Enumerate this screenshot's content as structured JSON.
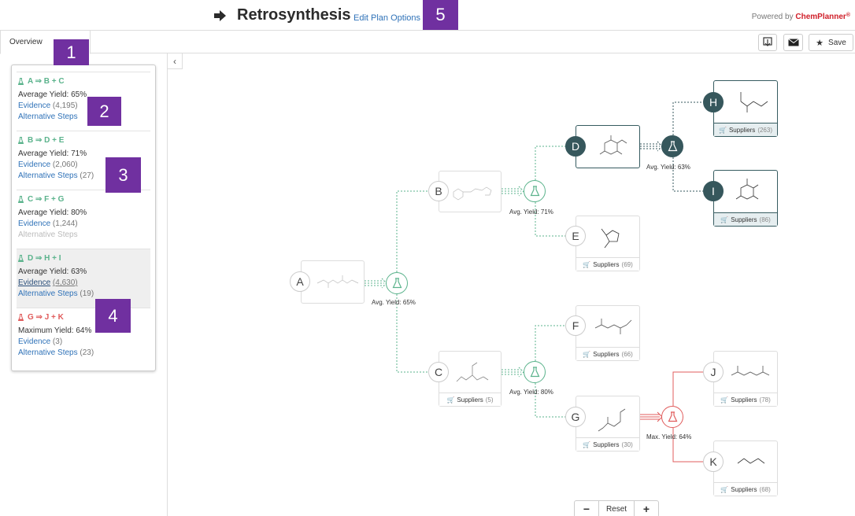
{
  "header": {
    "title": "Retrosynthesis",
    "edit_link": "Edit Plan Options",
    "powered_prefix": "Powered by ",
    "powered_brand": "ChemPlanner",
    "powered_mark": "®"
  },
  "tabs": {
    "overview": "Overview"
  },
  "toolbar": {
    "save_label": "Save"
  },
  "sidebar": {
    "steps": [
      {
        "title": "A ⇒ B + C",
        "yield": "Average Yield: 65%",
        "evidence_label": "Evidence",
        "evidence_count": "(4,195)",
        "alt_label": "Alternative Steps",
        "alt_count": "",
        "color": "#5bb38c"
      },
      {
        "title": "B ⇒ D + E",
        "yield": "Average Yield: 71%",
        "evidence_label": "Evidence",
        "evidence_count": "(2,060)",
        "alt_label": "Alternative Steps",
        "alt_count": "(27)",
        "color": "#5bb38c"
      },
      {
        "title": "C ⇒ F + G",
        "yield": "Average Yield: 80%",
        "evidence_label": "Evidence",
        "evidence_count": "(1,244)",
        "alt_label": "Alternative Steps",
        "alt_count": "",
        "color": "#5bb38c"
      },
      {
        "title": "D ⇒ H + I",
        "yield": "Average Yield: 63%",
        "evidence_label": "Evidence",
        "evidence_count": "(4,630)",
        "alt_label": "Alternative Steps",
        "alt_count": "(19)",
        "color": "#5bb38c"
      },
      {
        "title": "G ⇒ J + K",
        "yield": "Maximum Yield: 64%",
        "evidence_label": "Evidence",
        "evidence_count": "(3)",
        "alt_label": "Alternative Steps",
        "alt_count": "(23)",
        "color": "#e05c5c"
      }
    ]
  },
  "badges": [
    "1",
    "2",
    "3",
    "4",
    "5"
  ],
  "tree": {
    "nodes": {
      "A": "A",
      "B": "B",
      "C": "C",
      "D": "D",
      "E": "E",
      "F": "F",
      "G": "G",
      "H": "H",
      "I": "I",
      "J": "J",
      "K": "K"
    },
    "suppliers_label": "Suppliers",
    "supplier_counts": {
      "C": "(5)",
      "E": "(69)",
      "F": "(66)",
      "G": "(30)",
      "H": "(263)",
      "I": "(86)",
      "J": "(78)",
      "K": "(68)"
    },
    "yields": {
      "A": "Avg. Yield: 65%",
      "B": "Avg. Yield: 71%",
      "C": "Avg. Yield: 80%",
      "D": "Avg. Yield: 63%",
      "G": "Max. Yield: 64%"
    }
  },
  "zoom": {
    "minus": "−",
    "reset": "Reset",
    "plus": "+"
  },
  "colors": {
    "accent_green": "#5bb38c",
    "accent_red": "#e05c5c",
    "dark_teal": "#36575c",
    "badge": "#7030a0",
    "link": "#2f72b8"
  }
}
